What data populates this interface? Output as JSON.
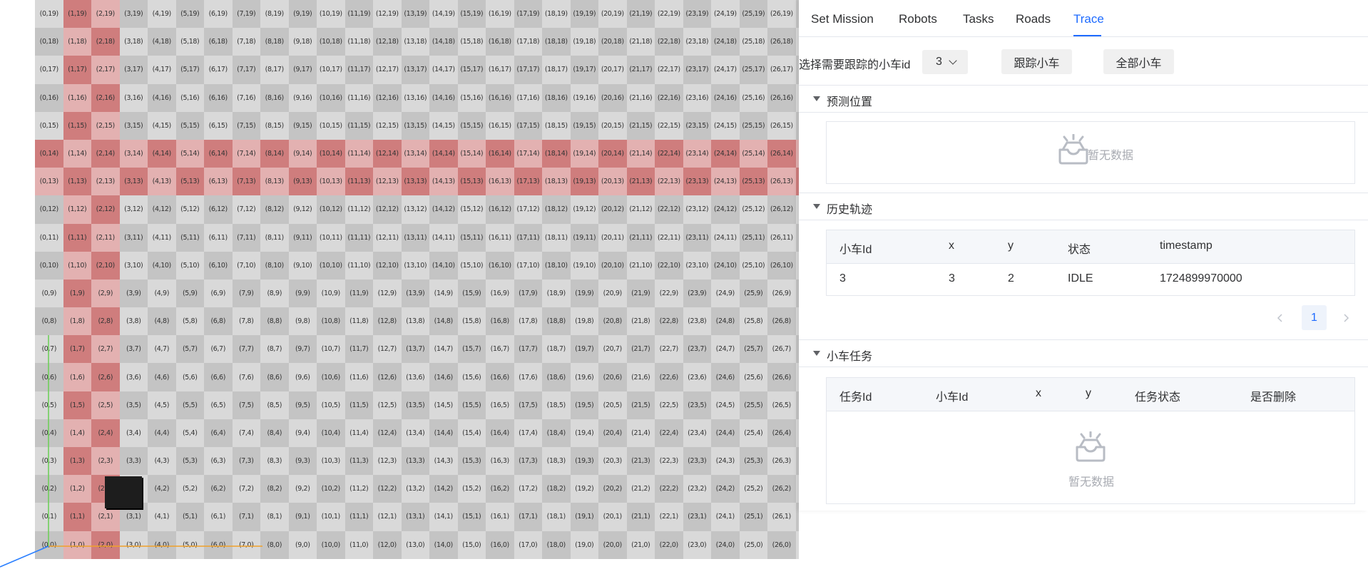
{
  "tabs": [
    "Set Mission",
    "Robots",
    "Tasks",
    "Roads",
    "Trace"
  ],
  "active_tab": "Trace",
  "trace": {
    "select_label": "选择需要跟踪的小车id",
    "selected_robot": "3",
    "track_button": "跟踪小车",
    "all_button": "全部小车"
  },
  "sections": {
    "predicted": "预测位置",
    "history": "历史轨迹",
    "tasks": "小车任务"
  },
  "empty_text": "暂无数据",
  "history_table": {
    "columns": [
      "小车Id",
      "x",
      "y",
      "状态",
      "timestamp"
    ],
    "rows": [
      [
        "3",
        "3",
        "2",
        "IDLE",
        "1724899970000"
      ]
    ]
  },
  "pagination": {
    "current": "1"
  },
  "tasks_table": {
    "columns": [
      "任务Id",
      "小车Id",
      "x",
      "y",
      "任务状态",
      "是否删除"
    ]
  },
  "grid": {
    "cols": 28,
    "rows": 20,
    "red_rows": [
      13,
      14
    ],
    "red_cols": [
      1,
      2
    ],
    "robot_cell": [
      3,
      2
    ],
    "axes_colors": {
      "x_axis": "#f0a12a",
      "y_axis": "#6fcf5a",
      "z_axis": "#2a7fff"
    }
  }
}
